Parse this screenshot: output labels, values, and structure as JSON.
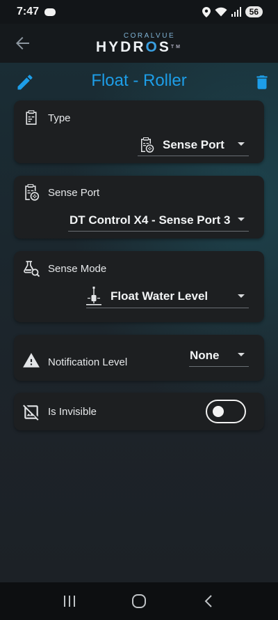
{
  "status_bar": {
    "time": "7:47",
    "battery": "56"
  },
  "app_header": {
    "logo_top": "CORALVUE",
    "logo_main_a": "HYDR",
    "logo_main_b": "O",
    "logo_main_c": "S",
    "logo_tm": "TM"
  },
  "page": {
    "title": "Float - Roller"
  },
  "fields": {
    "type": {
      "label": "Type",
      "value": "Sense Port"
    },
    "sense_port": {
      "label": "Sense Port",
      "value": "DT Control X4 - Sense Port 3"
    },
    "sense_mode": {
      "label": "Sense Mode",
      "value": "Float Water Level"
    },
    "notification_level": {
      "label": "Notification Level",
      "value": "None"
    },
    "is_invisible": {
      "label": "Is Invisible",
      "checked": false
    }
  },
  "colors": {
    "accent": "#1d9ee8",
    "card": "#1d1f21",
    "background": "#1c2126"
  }
}
